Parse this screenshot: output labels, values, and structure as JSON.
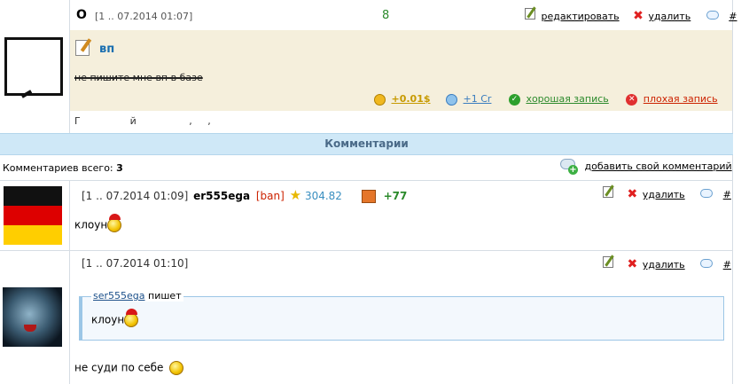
{
  "post": {
    "author_initial": "O",
    "timestamp": "[1 .. 07.2014 01:07]",
    "rating": "8",
    "actions": {
      "edit": "редактировать",
      "delete": "удалить",
      "anchor": "#"
    },
    "entry_title": "вп",
    "entry_text": "не пишите мне вп в базе",
    "money": "+0.01$",
    "cr": "+1 Cr",
    "good": "хорошая запись",
    "bad": "плохая запись",
    "footer_text": "Г                й                 ,     ,"
  },
  "comments_bar": {
    "title": "Комментарии"
  },
  "comments_summary": {
    "label": "Комментариев всего:",
    "count": "3",
    "add_link": "добавить свой комментарий"
  },
  "comments": [
    {
      "timestamp": "[1 .. 07.2014 01:09]",
      "username": "er555ega",
      "ban": "[ban]",
      "score": "304.82",
      "bonus": "+77",
      "text": "клоун",
      "delete": "удалить",
      "anchor": "#"
    },
    {
      "timestamp": "[1 .. 07.2014 01:10]",
      "quote_author": "ser555ega",
      "quote_label": "пишет",
      "quote_text": "клоун",
      "text": "не суди по себе",
      "delete": "удалить",
      "anchor": "#"
    }
  ],
  "colors": {
    "post_bg": "#f5efdc",
    "comments_bar_bg": "#cfe8f7",
    "quote_border": "#9cc6e6",
    "rating_green": "#2b8a2b",
    "bad_red": "#cc2200",
    "money_gold": "#c79a00",
    "cr_blue": "#3a7dbf"
  }
}
